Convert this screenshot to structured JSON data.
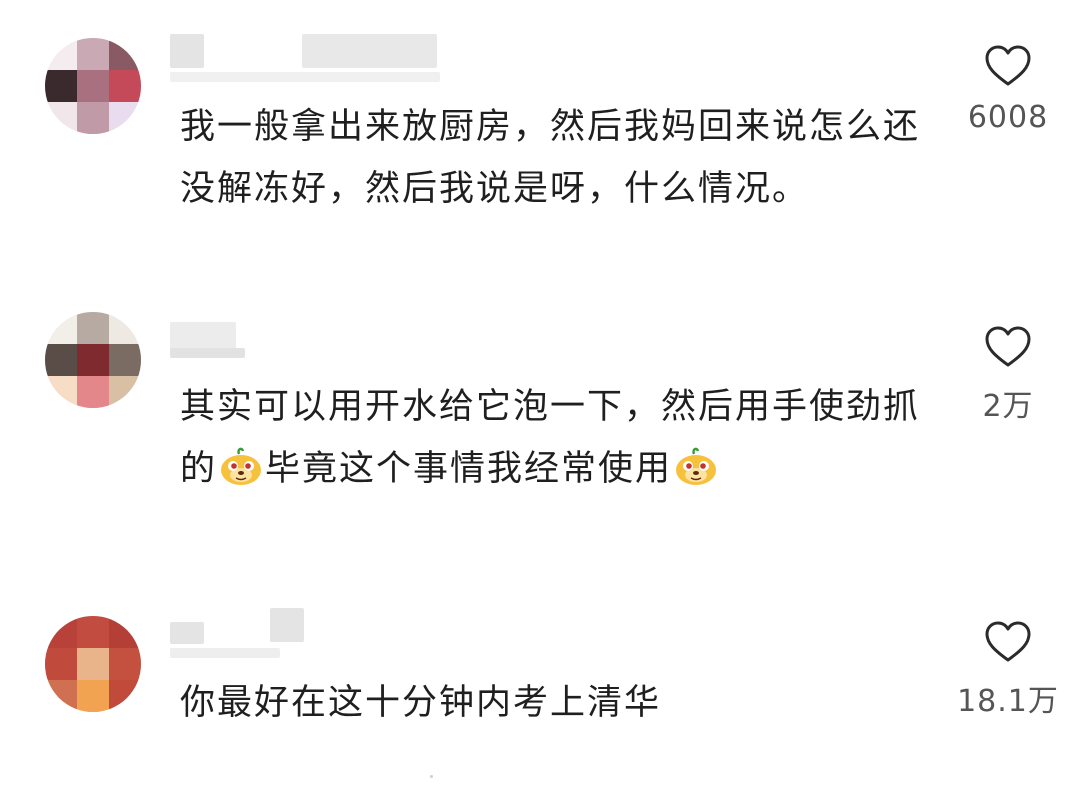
{
  "comments": [
    {
      "text": "我一般拿出来放厨房，然后我妈回来说怎么还没解冻好，然后我说是呀，什么情况。",
      "likes": "6008"
    },
    {
      "text_part1": "其实可以用开水给它泡一下，然后用手使劲抓的",
      "text_part2": "毕竟这个事情我经常使用",
      "likes": "2万",
      "emoji_icon": "doge-emoji-icon"
    },
    {
      "text": "你最好在这十分钟内考上清华",
      "likes": "18.1万"
    }
  ],
  "colors": {
    "text": "#1f1f1f",
    "count": "#555555",
    "heart_stroke": "#2b2b2b"
  },
  "icons": {
    "like": "heart-outline-icon",
    "emoji": "doge-emoji-icon"
  }
}
